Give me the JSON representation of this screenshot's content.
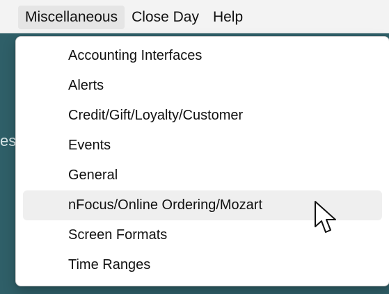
{
  "menubar": {
    "items": [
      {
        "id": "miscellaneous",
        "label": "Miscellaneous",
        "active": true
      },
      {
        "id": "close-day",
        "label": "Close Day",
        "active": false
      },
      {
        "id": "help",
        "label": "Help",
        "active": false
      }
    ]
  },
  "background": {
    "fragment_text": "es"
  },
  "dropdown": {
    "items": [
      {
        "id": "accounting-interfaces",
        "label": "Accounting Interfaces",
        "highlighted": false
      },
      {
        "id": "alerts",
        "label": "Alerts",
        "highlighted": false
      },
      {
        "id": "credit-gift-loyalty-customer",
        "label": "Credit/Gift/Loyalty/Customer",
        "highlighted": false
      },
      {
        "id": "events",
        "label": "Events",
        "highlighted": false
      },
      {
        "id": "general",
        "label": "General",
        "highlighted": false
      },
      {
        "id": "nfocus-online-ordering-mozart",
        "label": "nFocus/Online Ordering/Mozart",
        "highlighted": true
      },
      {
        "id": "screen-formats",
        "label": "Screen Formats",
        "highlighted": false
      },
      {
        "id": "time-ranges",
        "label": "Time Ranges",
        "highlighted": false
      }
    ]
  },
  "colors": {
    "app_bg": "#2f5f68",
    "menubar_bg": "#f3f3f3",
    "menubar_active_bg": "#e5e5e5",
    "dropdown_bg": "#ffffff",
    "dropdown_highlight_bg": "#efefef",
    "text": "#111111"
  },
  "icons": {
    "cursor": "mouse-pointer-icon"
  }
}
